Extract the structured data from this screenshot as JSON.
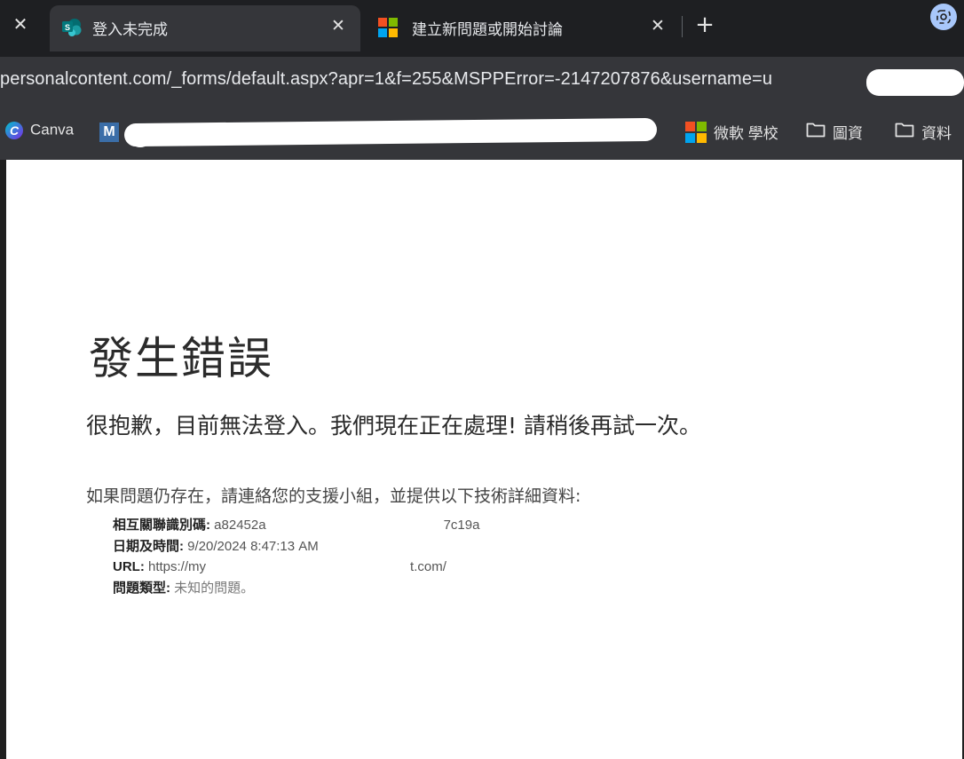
{
  "browser": {
    "tabs": [
      {
        "title": "登入未完成",
        "favicon": "sharepoint-icon",
        "active": true,
        "close_glyph": "✕"
      },
      {
        "title": "建立新問題或開始討論",
        "favicon": "microsoft-logo-icon",
        "active": false,
        "close_glyph": "✕"
      }
    ],
    "left_close_glyph": "✕",
    "new_tab_glyph": "+",
    "address": "personalcontent.com/_forms/default.aspx?apr=1&f=255&MSPPError=-2147207876&username=u",
    "bookmarks": [
      {
        "label": "Canva",
        "icon": "canva-icon"
      },
      {
        "label": "M",
        "icon": "m-icon"
      },
      {
        "label": "微軟 學校",
        "icon": "microsoft-logo-icon"
      },
      {
        "label": "圖資",
        "icon": "folder-icon"
      },
      {
        "label": "資料",
        "icon": "folder-icon"
      }
    ],
    "bookmark_fragment": "學",
    "ms_colors": [
      "#f25022",
      "#7fba00",
      "#00a4ef",
      "#ffb900"
    ]
  },
  "page": {
    "title": "發生錯誤",
    "message": "很抱歉，目前無法登入。我們現在正在處理! 請稍後再試一次。",
    "help": "如果問題仍存在，請連絡您的支援小組，並提供以下技術詳細資料:",
    "details": {
      "correlation_label": "相互關聯識別碼:",
      "correlation_value_start": "a82452a",
      "correlation_value_mid": "",
      "correlation_value_end": "7c19a",
      "datetime_label": "日期及時間:",
      "datetime_value": "9/20/2024 8:47:13 AM",
      "url_label": "URL:",
      "url_value_start": "https://my",
      "url_value_end": "t.com/",
      "issue_label": "問題類型:",
      "issue_value": "未知的問題。"
    }
  }
}
